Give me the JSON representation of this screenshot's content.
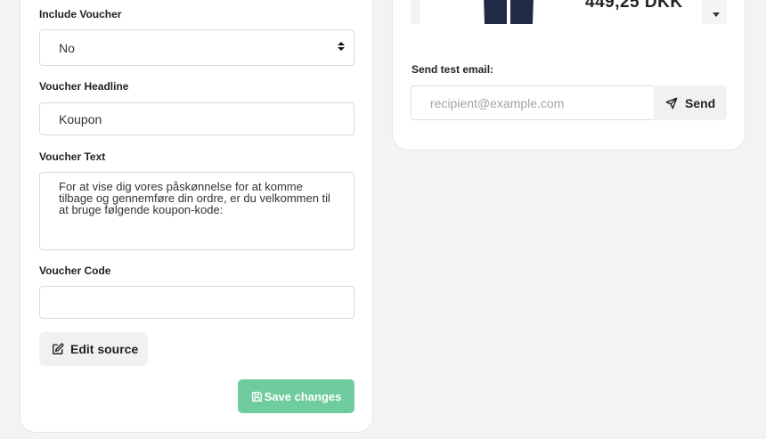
{
  "form": {
    "include_voucher": {
      "label": "Include Voucher",
      "value": "No"
    },
    "voucher_headline": {
      "label": "Voucher Headline",
      "value": "Koupon"
    },
    "voucher_text": {
      "label": "Voucher Text",
      "value": "For at vise dig vores påskønnelse for at komme tilbage og gennemføre din ordre, er du velkommen til at bruge følgende koupon-kode:"
    },
    "voucher_code": {
      "label": "Voucher Code",
      "value": ""
    },
    "edit_source_label": "Edit source",
    "save_label": "Save changes"
  },
  "preview": {
    "price": "449,25 DKK"
  },
  "test_email": {
    "label": "Send test email:",
    "placeholder": "recipient@example.com",
    "send_label": "Send"
  },
  "colors": {
    "save_button": "#6fcc9e",
    "background": "#f3f3f4"
  }
}
